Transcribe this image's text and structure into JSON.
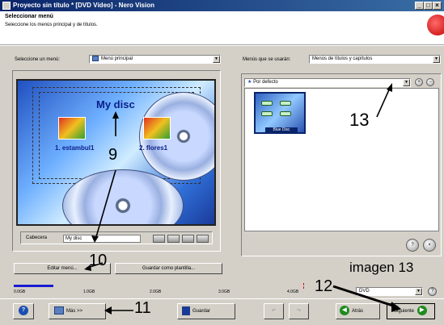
{
  "window": {
    "title": "Proyecto sin título * [DVD Vídeo] - Nero Vision",
    "min_label": "_",
    "max_label": "□",
    "close_label": "×"
  },
  "header": {
    "title": "Seleccionar menú",
    "subtitle": "Seleccione los menús principal y de títulos."
  },
  "menu_select": {
    "label": "Seleccione un menú:",
    "value": "Menú principal"
  },
  "menus_used": {
    "label": "Menús que se usarán:",
    "value": "Menús de títulos y capítulos"
  },
  "preview": {
    "disc_title": "My disc",
    "items": [
      {
        "label": "1. estambul1"
      },
      {
        "label": "2. flores1"
      }
    ]
  },
  "caption": {
    "label": "Cabecera",
    "value": "My disc"
  },
  "buttons": {
    "edit_menu": "Editar menú...",
    "save_template": "Guardar como plantilla...",
    "more": "Más >>",
    "save": "Guardar",
    "back": "Atrás",
    "next": "Siguiente"
  },
  "templates": {
    "selected": "Por defecto",
    "thumb_name": "Blue Disc"
  },
  "capacity": {
    "ticks": [
      "0.0GB",
      "1.0GB",
      "2.0GB",
      "3.0GB",
      "4.0GB"
    ],
    "used_fraction": 0.12,
    "format": "DVD"
  },
  "annotations": {
    "n9": "9",
    "n10": "10",
    "n11": "11",
    "n12": "12",
    "n13": "13",
    "caption": "imagen 13"
  },
  "colors": {
    "title_bar": "#0a246a",
    "accent_green": "#1f8a1f",
    "accent_blue": "#1a4fb0"
  }
}
